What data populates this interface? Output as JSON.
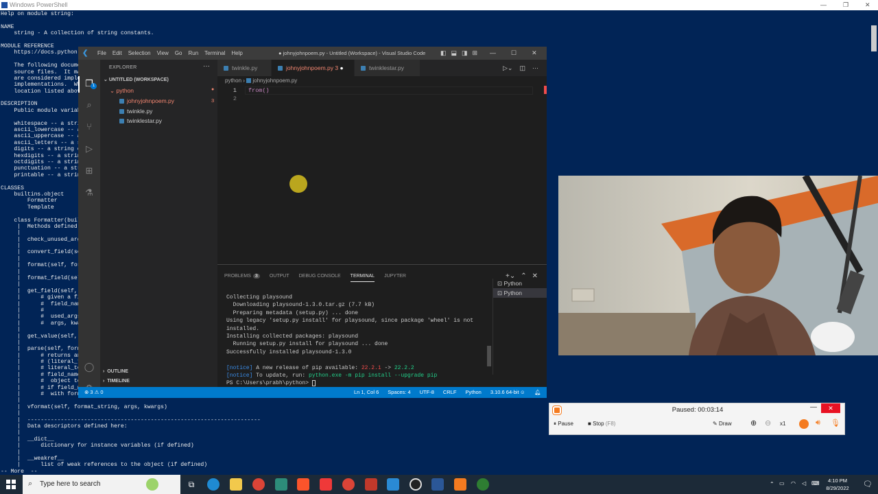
{
  "powershell": {
    "title": "Windows PowerShell",
    "lines": [
      "Help on module string:",
      "",
      "NAME",
      "    string - A collection of string constants.",
      "",
      "MODULE REFERENCE",
      "    https://docs.python.o",
      "",
      "    The following docume",
      "    source files.  It ma",
      "    are considered imple",
      "    implementations.  Whe",
      "    location listed above",
      "",
      "DESCRIPTION",
      "    Public module variab",
      "",
      "    whitespace -- a stri",
      "    ascii_lowercase -- a",
      "    ascii_uppercase -- a",
      "    ascii_letters -- a s",
      "    digits -- a string c",
      "    hexdigits -- a string",
      "    octdigits -- a string",
      "    punctuation -- a str",
      "    printable -- a string",
      "",
      "CLASSES",
      "    builtins.object",
      "        Formatter",
      "        Template",
      "",
      "    class Formatter(built",
      "     |  Methods defined h",
      "     |",
      "     |  check_unused_args",
      "     |",
      "     |  convert_field(sel",
      "     |",
      "     |  format(self, for",
      "     |",
      "     |  format_field(self",
      "     |",
      "     |  get_field(self, f",
      "     |      # given a fie",
      "     |      #  field_name",
      "     |      #",
      "     |      #  used_args",
      "     |      #  args, kwar",
      "     |",
      "     |  get_value(self, k",
      "     |",
      "     |  parse(self, forma",
      "     |      # returns an",
      "     |      # (literal_te",
      "     |      # literal_tex",
      "     |      # field_name",
      "     |      #  object to",
      "     |      # if field_na",
      "     |      #  with forma",
      "     |",
      "     |  vformat(self, format_string, args, kwargs)",
      "     |",
      "     |  ----------------------------------------------------------------------",
      "     |  Data descriptors defined here:",
      "     |",
      "     |  __dict__",
      "     |      dictionary for instance variables (if defined)",
      "     |",
      "     |  __weakref__",
      "     |      list of weak references to the object (if defined)",
      "-- More  --"
    ]
  },
  "vscode": {
    "menu": [
      "File",
      "Edit",
      "Selection",
      "View",
      "Go",
      "Run",
      "Terminal",
      "Help"
    ],
    "window_title": "● johnyjohnpoem.py - Untitled (Workspace) - Visual Studio Code",
    "explorer_header": "EXPLORER",
    "workspace": "UNTITLED (WORKSPACE)",
    "folder": "python",
    "files": [
      {
        "name": "johnyjohnpoem.py",
        "badge": "3",
        "color": "#f48771"
      },
      {
        "name": "twinkle.py",
        "badge": "",
        "color": "#cccccc"
      },
      {
        "name": "twinklestar.py",
        "badge": "",
        "color": "#cccccc"
      }
    ],
    "outline": "OUTLINE",
    "timeline": "TIMELINE",
    "tabs": [
      {
        "label": "twinkle.py",
        "suffix": ""
      },
      {
        "label": "johnyjohnpoem.py",
        "suffix": "3"
      },
      {
        "label": "twinklestar.py",
        "suffix": ""
      }
    ],
    "breadcrumb": [
      "python",
      "johnyjohnpoem.py"
    ],
    "code_lines": [
      "from()",
      ""
    ],
    "line_numbers": [
      "1",
      "2"
    ],
    "panel_tabs": [
      "PROBLEMS",
      "OUTPUT",
      "DEBUG CONSOLE",
      "TERMINAL",
      "JUPYTER"
    ],
    "problems_count": "3",
    "terminal_lines": [
      "Collecting playsound",
      "  Downloading playsound-1.3.0.tar.gz (7.7 kB)",
      "  Preparing metadata (setup.py) ... done",
      "Using legacy 'setup.py install' for playsound, since package 'wheel' is not installed.",
      "Installing collected packages: playsound",
      "  Running setup.py install for playsound ... done",
      "Successfully installed playsound-1.3.0",
      ""
    ],
    "notice1": {
      "tag": "[notice]",
      "text": " A new release of pip available: ",
      "old": "22.2.1",
      "arrow": " -> ",
      "new": "22.2.2"
    },
    "notice2": {
      "tag": "[notice]",
      "text": " To update, run: ",
      "cmd": "python.exe -m pip install --upgrade pip"
    },
    "prompt": "PS C:\\Users\\prabh\\python> ",
    "terminal_list": [
      "Python",
      "Python"
    ],
    "status_left": "⊗ 3  ⚠ 0",
    "status_items": [
      "Ln 1, Col 6",
      "Spaces: 4",
      "UTF-8",
      "CRLF",
      "Python",
      "3.10.6 64-bit"
    ]
  },
  "recorder": {
    "status": "Paused: 00:03:14",
    "pause": "Pause",
    "stop": "Stop",
    "stop_key": "(F8)",
    "draw": "Draw",
    "zoom": "x1"
  },
  "taskbar": {
    "search_placeholder": "Type here to search",
    "time": "4:10 PM",
    "date": "8/29/2022"
  }
}
